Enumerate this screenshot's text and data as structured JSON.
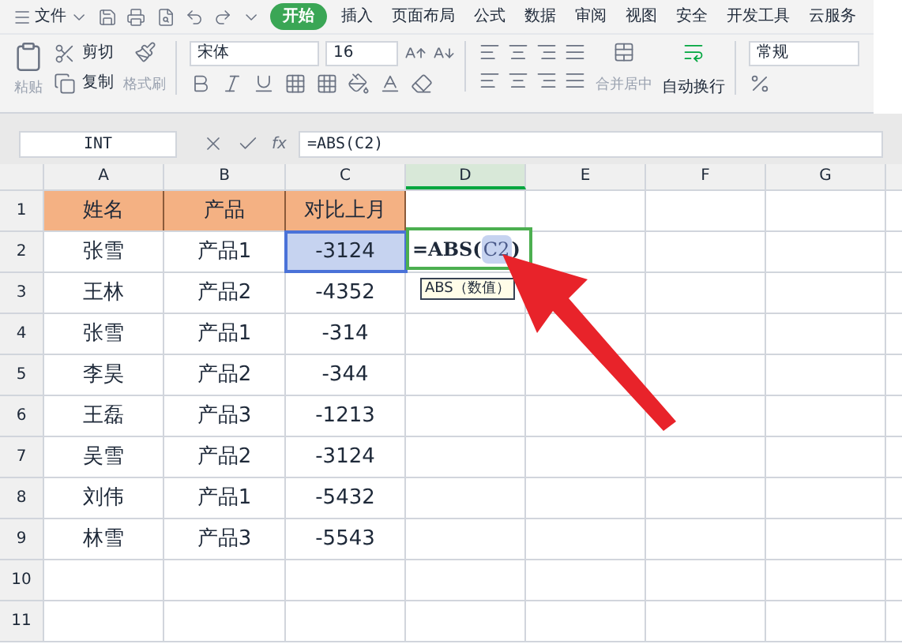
{
  "menu": {
    "file": "文件",
    "tabs": [
      {
        "label": "开始",
        "selected": true
      },
      {
        "label": "插入",
        "selected": false
      },
      {
        "label": "页面布局",
        "selected": false
      },
      {
        "label": "公式",
        "selected": false
      },
      {
        "label": "数据",
        "selected": false
      },
      {
        "label": "审阅",
        "selected": false
      },
      {
        "label": "视图",
        "selected": false
      },
      {
        "label": "安全",
        "selected": false
      },
      {
        "label": "开发工具",
        "selected": false
      },
      {
        "label": "云服务",
        "selected": false
      }
    ]
  },
  "ribbon": {
    "paste": "粘贴",
    "cut": "剪切",
    "copy": "复制",
    "format_painter": "格式刷",
    "font": "宋体",
    "font_size": "16",
    "merge": "合并居中",
    "wrap": "自动换行",
    "number_format": "常规"
  },
  "formula_bar": {
    "name_box": "INT",
    "function_label": "fx",
    "formula": "=ABS(C2)"
  },
  "header_row": {
    "label": "1",
    "cells": [
      "姓名",
      "产品",
      "对比上月"
    ]
  },
  "columns": [
    {
      "label": "A",
      "active": false
    },
    {
      "label": "B",
      "active": false
    },
    {
      "label": "C",
      "active": false
    },
    {
      "label": "D",
      "active": true
    },
    {
      "label": "E",
      "active": false
    },
    {
      "label": "F",
      "active": false
    },
    {
      "label": "G",
      "active": false
    }
  ],
  "rows": [
    {
      "label": "2",
      "cells": [
        {
          "text": "张雪",
          "referenced": false
        },
        {
          "text": "产品1",
          "referenced": false
        },
        {
          "text": "-3124",
          "referenced": true
        }
      ]
    },
    {
      "label": "3",
      "cells": [
        {
          "text": "王林",
          "referenced": false
        },
        {
          "text": "产品2",
          "referenced": false
        },
        {
          "text": "-4352",
          "referenced": false
        }
      ]
    },
    {
      "label": "4",
      "cells": [
        {
          "text": "张雪",
          "referenced": false
        },
        {
          "text": "产品1",
          "referenced": false
        },
        {
          "text": "-314",
          "referenced": false
        }
      ]
    },
    {
      "label": "5",
      "cells": [
        {
          "text": "李昊",
          "referenced": false
        },
        {
          "text": "产品2",
          "referenced": false
        },
        {
          "text": "-344",
          "referenced": false
        }
      ]
    },
    {
      "label": "6",
      "cells": [
        {
          "text": "王磊",
          "referenced": false
        },
        {
          "text": "产品3",
          "referenced": false
        },
        {
          "text": "-1213",
          "referenced": false
        }
      ]
    },
    {
      "label": "7",
      "cells": [
        {
          "text": "吴雪",
          "referenced": false
        },
        {
          "text": "产品2",
          "referenced": false
        },
        {
          "text": "-3124",
          "referenced": false
        }
      ]
    },
    {
      "label": "8",
      "cells": [
        {
          "text": "刘伟",
          "referenced": false
        },
        {
          "text": "产品1",
          "referenced": false
        },
        {
          "text": "-5432",
          "referenced": false
        }
      ]
    },
    {
      "label": "9",
      "cells": [
        {
          "text": "林雪",
          "referenced": false
        },
        {
          "text": "产品3",
          "referenced": false
        },
        {
          "text": "-5543",
          "referenced": false
        }
      ]
    },
    {
      "label": "10",
      "cells": []
    },
    {
      "label": "11",
      "cells": []
    }
  ],
  "cell_editor": {
    "prefix": "=ABS(",
    "reference": "C2",
    "suffix": ")",
    "tooltip": "ABS（数值）"
  }
}
